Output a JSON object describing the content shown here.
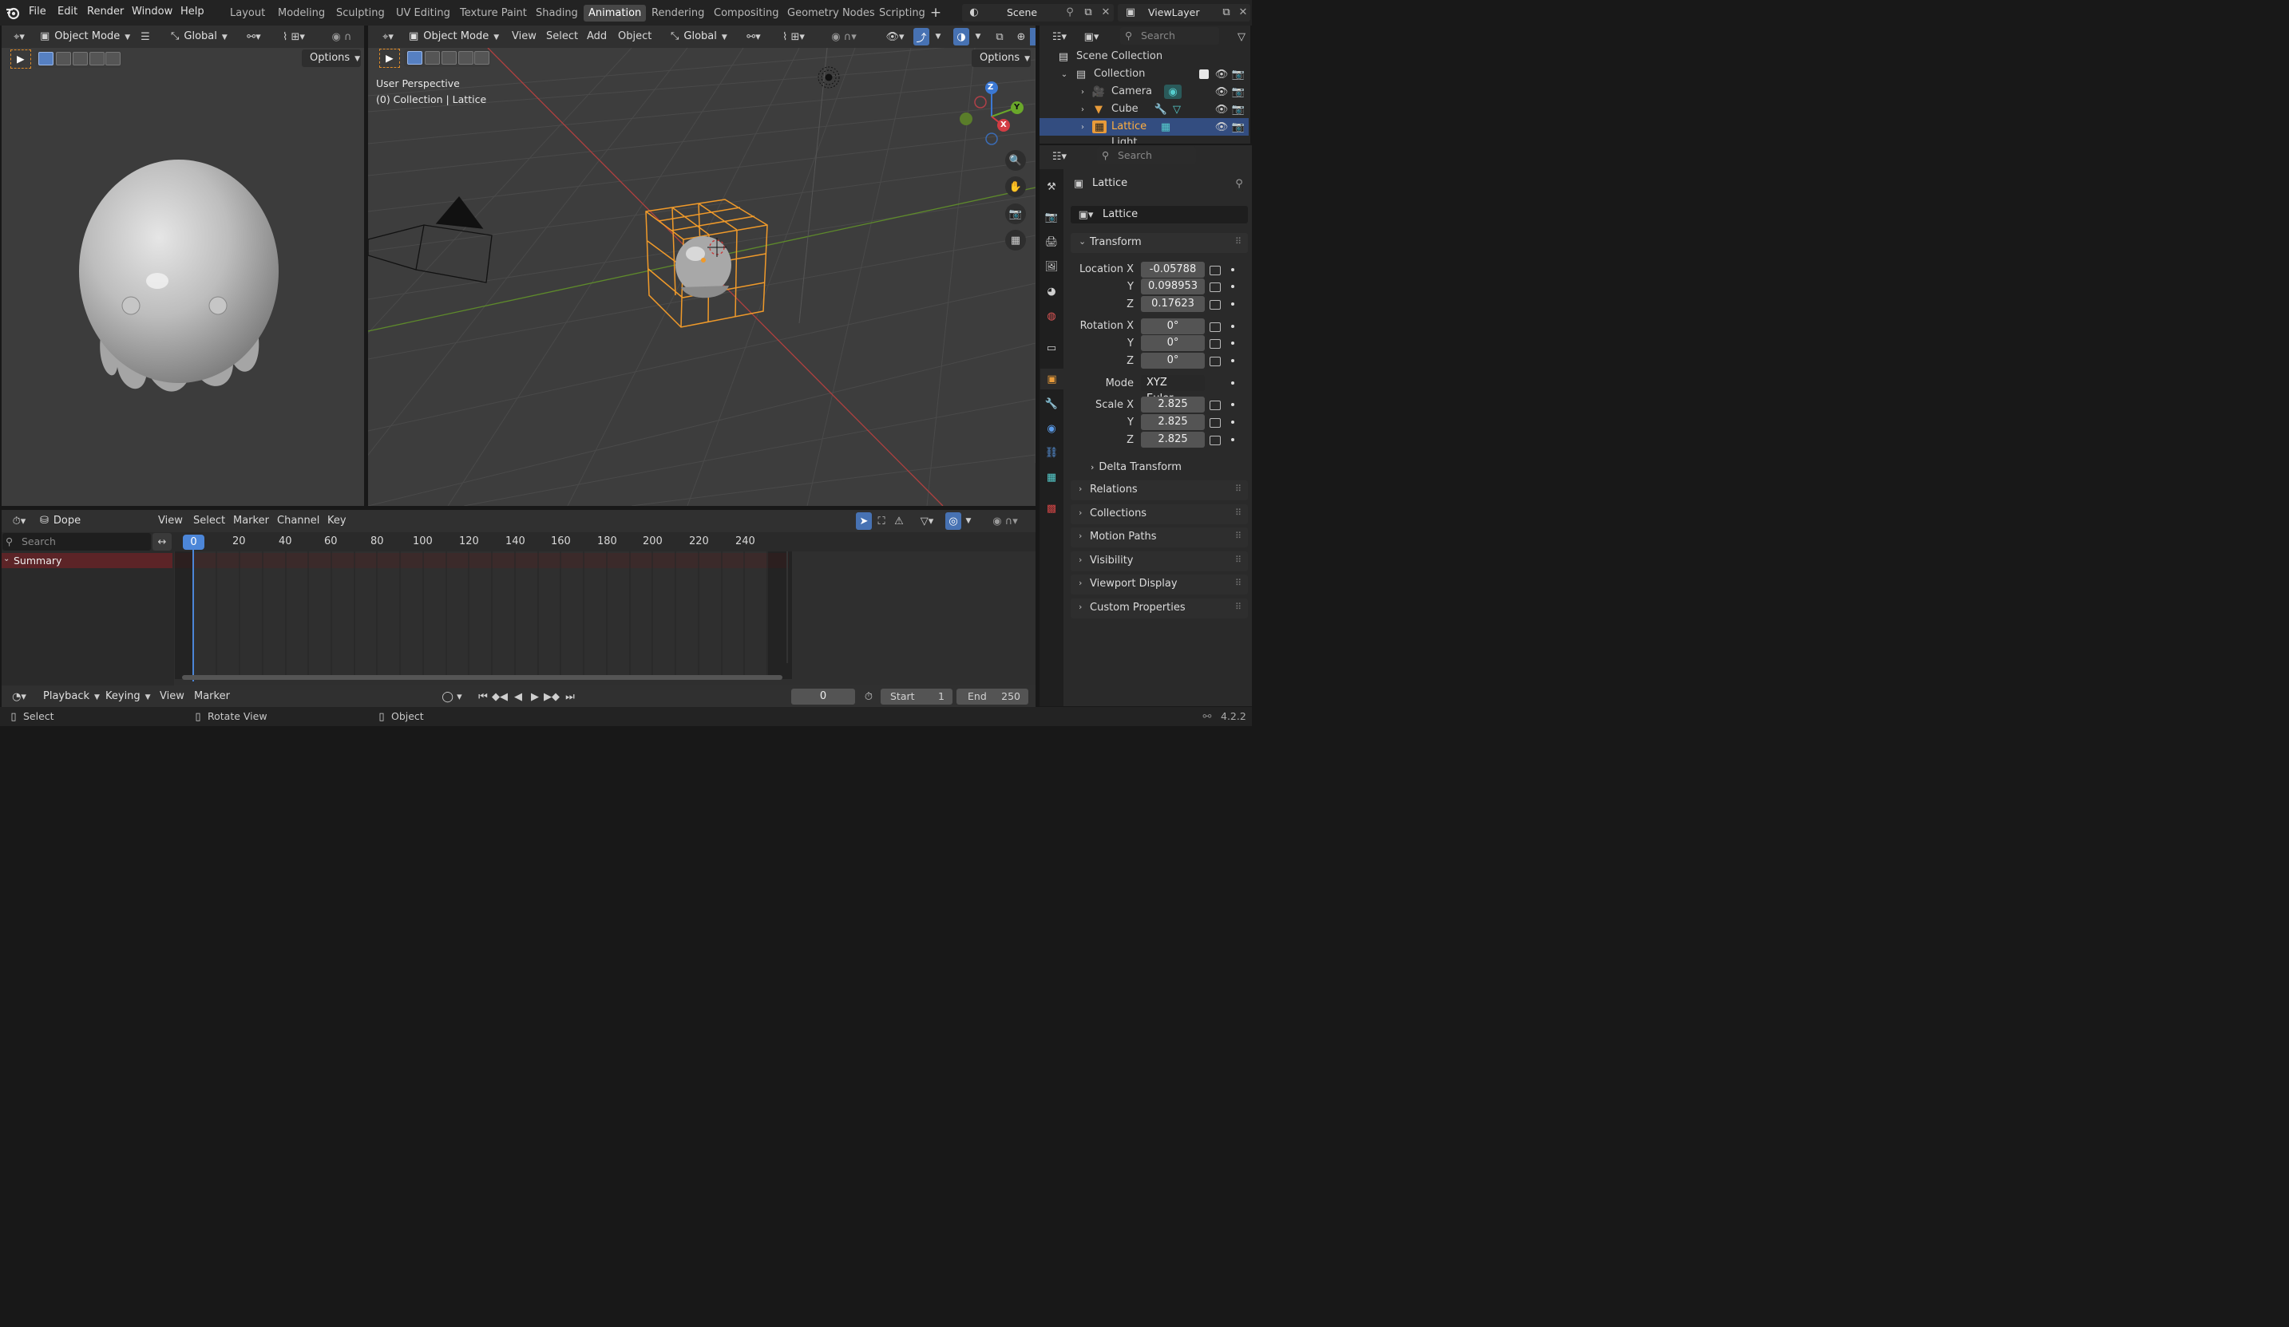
{
  "menu": {
    "file": "File",
    "edit": "Edit",
    "render": "Render",
    "window": "Window",
    "help": "Help"
  },
  "workspaces": [
    "Layout",
    "Modeling",
    "Sculpting",
    "UV Editing",
    "Texture Paint",
    "Shading",
    "Animation",
    "Rendering",
    "Compositing",
    "Geometry Nodes",
    "Scripting"
  ],
  "active_workspace": "Animation",
  "scene": "Scene",
  "view_layer": "ViewLayer",
  "left_vp": {
    "mode": "Object Mode",
    "orientation": "Global",
    "options": "Options"
  },
  "main_vp": {
    "mode": "Object Mode",
    "view": "View",
    "select": "Select",
    "add": "Add",
    "object": "Object",
    "orientation": "Global",
    "options": "Options",
    "overlay_line1": "User Perspective",
    "overlay_line2": "(0) Collection | Lattice"
  },
  "gizmo": {
    "z": "Z",
    "y": "Y",
    "x": "X"
  },
  "outliner": {
    "search_placeholder": "Search",
    "scene_collection": "Scene Collection",
    "collection": "Collection",
    "items": [
      {
        "name": "Camera"
      },
      {
        "name": "Cube"
      },
      {
        "name": "Lattice"
      },
      {
        "name": "Light"
      }
    ]
  },
  "properties": {
    "search_placeholder": "Search",
    "object_name": "Lattice",
    "datablock": "Lattice",
    "transform_title": "Transform",
    "location": {
      "label": "Location X",
      "x": "-0.05788",
      "y": "0.098953",
      "z": "0.17623"
    },
    "rotation": {
      "label": "Rotation X",
      "x": "0°",
      "y": "0°",
      "z": "0°"
    },
    "mode": {
      "label": "Mode",
      "value": "XYZ Euler"
    },
    "scale": {
      "label": "Scale X",
      "x": "2.825",
      "y": "2.825",
      "z": "2.825"
    },
    "axis_y": "Y",
    "axis_z": "Z",
    "delta": "Delta Transform",
    "panels": [
      "Relations",
      "Collections",
      "Motion Paths",
      "Visibility",
      "Viewport Display",
      "Custom Properties"
    ]
  },
  "dopesheet": {
    "editor": "Dope Sheet",
    "view": "View",
    "select": "Select",
    "marker": "Marker",
    "channel": "Channel",
    "key": "Key",
    "search_placeholder": "Search",
    "summary": "Summary",
    "current_frame": "0",
    "ticks": [
      "20",
      "40",
      "60",
      "80",
      "100",
      "120",
      "140",
      "160",
      "180",
      "200",
      "220",
      "240"
    ]
  },
  "timeline": {
    "playback": "Playback",
    "keying": "Keying",
    "view": "View",
    "marker": "Marker",
    "frame": "0",
    "start_label": "Start",
    "start": "1",
    "end_label": "End",
    "end": "250"
  },
  "status": {
    "select": "Select",
    "rotate": "Rotate View",
    "object": "Object",
    "version": "4.2.2"
  }
}
